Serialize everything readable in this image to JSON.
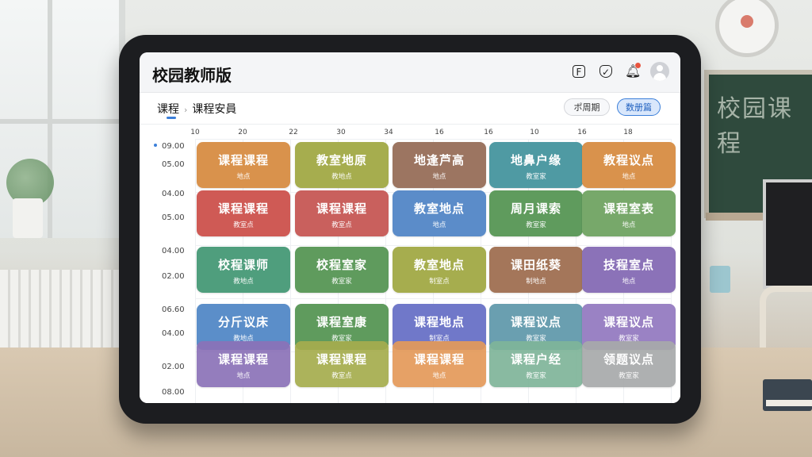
{
  "app": {
    "title": "校园教师版"
  },
  "toolbar": {
    "icon1": "F",
    "icon2": "✓"
  },
  "breadcrumb": {
    "root": "课程",
    "sep": "›",
    "current": "课程安員"
  },
  "actions": {
    "outline_label": "ポ周期",
    "primary_label": "数册篇"
  },
  "schedule": {
    "x_labels": [
      "10",
      "20",
      "22",
      "30",
      "34",
      "16",
      "16",
      "10",
      "16",
      "18"
    ],
    "y_labels": [
      "09.00",
      "05.00",
      "04.00",
      "05.00",
      "04.00",
      "02.00",
      "06.60",
      "04.00",
      "02.00",
      "08.00"
    ],
    "colors": {
      "orange": "#d9924c",
      "brown": "#9c7561",
      "teal": "#4f9aa3",
      "red": "#cf5a55",
      "rose": "#c9605d",
      "blue": "#5b8cc9",
      "green": "#5f9b5d",
      "sage": "#77a86a",
      "seagreen": "#4f9e7d",
      "olive": "#a6ad4e",
      "tan": "#a4765a",
      "violet": "#8b72b8",
      "steelblue": "#5b8ec9",
      "indigo": "#7078c9",
      "slate": "#6a9fb0",
      "lilac": "#9a82c4",
      "peach": "#e49a5a",
      "mint": "#7fb59a",
      "gray": "#a8aaab"
    },
    "cards": [
      {
        "title": "课程课程",
        "sub": "地点",
        "color": "orange"
      },
      {
        "title": "教室地原",
        "sub": "教地点",
        "color": "olive"
      },
      {
        "title": "地逢芦高",
        "sub": "地点",
        "color": "brown"
      },
      {
        "title": "地鼻户缘",
        "sub": "教室家",
        "color": "teal"
      },
      {
        "title": "教程议点",
        "sub": "地点",
        "color": "orange"
      },
      {
        "title": "课程课程",
        "sub": "教室点",
        "color": "red"
      },
      {
        "title": "课程课程",
        "sub": "教室点",
        "color": "rose"
      },
      {
        "title": "教室地点",
        "sub": "地点",
        "color": "blue"
      },
      {
        "title": "周月课索",
        "sub": "教室家",
        "color": "green"
      },
      {
        "title": "课程室表",
        "sub": "地点",
        "color": "sage"
      },
      {
        "title": "校程课师",
        "sub": "教地点",
        "color": "seagreen"
      },
      {
        "title": "校程室家",
        "sub": "教室家",
        "color": "green"
      },
      {
        "title": "教室地点",
        "sub": "制室点",
        "color": "olive"
      },
      {
        "title": "课田纸葵",
        "sub": "制地点",
        "color": "tan"
      },
      {
        "title": "技程室点",
        "sub": "地点",
        "color": "violet"
      },
      {
        "title": "分斤议床",
        "sub": "教地点",
        "color": "steelblue"
      },
      {
        "title": "课程室康",
        "sub": "教室家",
        "color": "green"
      },
      {
        "title": "课程地点",
        "sub": "制室点",
        "color": "indigo"
      },
      {
        "title": "课程议点",
        "sub": "教室家",
        "color": "slate"
      },
      {
        "title": "课程议点",
        "sub": "教室家",
        "color": "lilac"
      },
      {
        "title": "课程课程",
        "sub": "地点",
        "color": "violet"
      },
      {
        "title": "课程课程",
        "sub": "教室点",
        "color": "olive"
      },
      {
        "title": "课程课程",
        "sub": "地点",
        "color": "peach"
      },
      {
        "title": "课程户经",
        "sub": "教室家",
        "color": "mint"
      },
      {
        "title": "领题议点",
        "sub": "教室家",
        "color": "gray"
      }
    ]
  },
  "scene": {
    "board_text": "校园课程"
  }
}
